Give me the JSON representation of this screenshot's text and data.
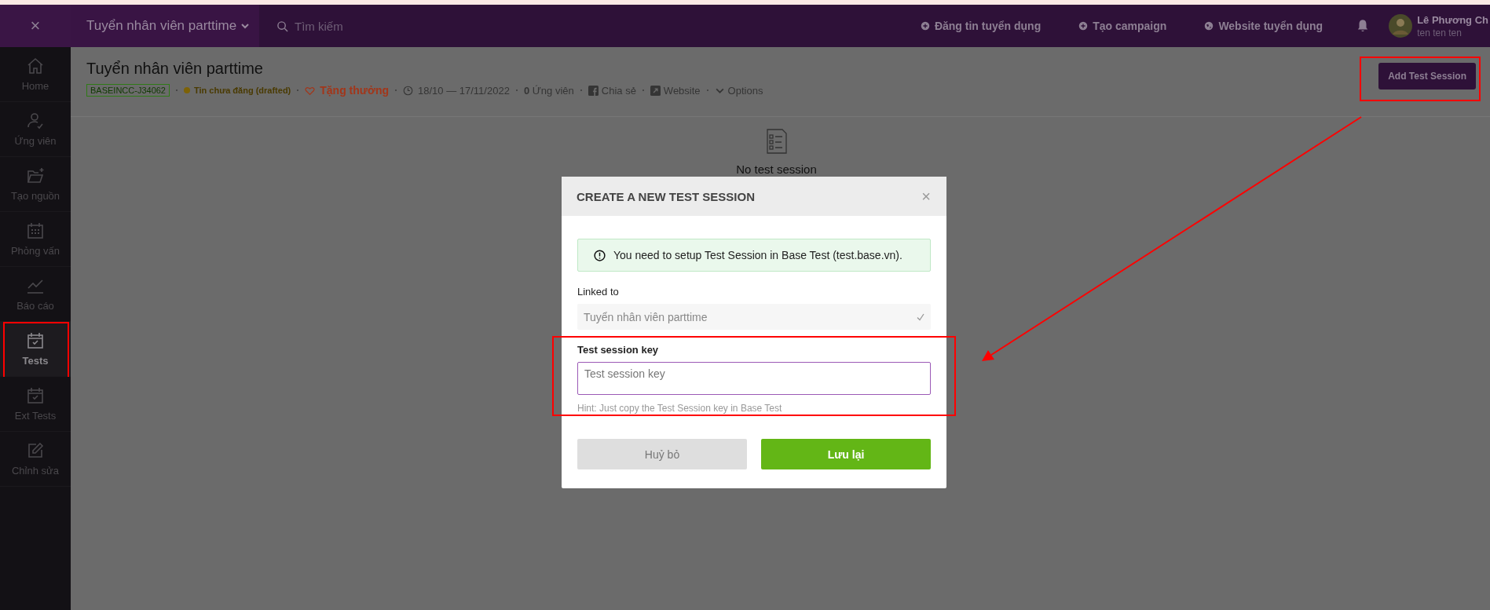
{
  "top_bar": {
    "close": "×",
    "job_selector": "Tuyển nhân viên parttime",
    "search": {
      "placeholder": "Tìm kiếm"
    },
    "actions": [
      {
        "label": "Đăng tin tuyển dụng",
        "kind": "plus"
      },
      {
        "label": "Tạo campaign",
        "kind": "plus"
      },
      {
        "label": "Website tuyển dụng",
        "kind": "globe"
      }
    ],
    "user": {
      "name": "Lê Phương Ch",
      "subtitle": "ten ten ten"
    }
  },
  "sidebar": {
    "items": [
      {
        "label": "Home",
        "kind": "home",
        "selected": false,
        "highlighted": false
      },
      {
        "label": "Ứng viên",
        "kind": "user",
        "selected": false,
        "highlighted": false
      },
      {
        "label": "Tạo nguồn",
        "kind": "folder",
        "selected": false,
        "highlighted": false
      },
      {
        "label": "Phỏng vấn",
        "kind": "calendar",
        "selected": false,
        "highlighted": false
      },
      {
        "label": "Báo cáo",
        "kind": "chart",
        "selected": false,
        "highlighted": false
      },
      {
        "label": "Tests",
        "kind": "test",
        "selected": true,
        "highlighted": true
      },
      {
        "label": "Ext Tests",
        "kind": "test",
        "selected": false,
        "highlighted": false
      },
      {
        "label": "Chỉnh sửa",
        "kind": "edit",
        "selected": false,
        "highlighted": false
      }
    ]
  },
  "job": {
    "title": "Tuyển nhân viên parttime",
    "code": "BASEINCC-J34062",
    "status": "Tin chưa đăng (drafted)",
    "reward": "Tặng thưởng",
    "dates": "18/10 — 17/11/2022",
    "applicants_count": "0",
    "applicants_label": "Ứng viên",
    "share": "Chia sẻ",
    "website": "Website",
    "options": "Options"
  },
  "add_button": {
    "label": "Add Test Session",
    "highlighted": true
  },
  "empty_state": {
    "text": "No test session"
  },
  "dialog": {
    "title": "CREATE A NEW TEST SESSION",
    "close": "×",
    "alert": "You need to setup Test Session in Base Test (test.base.vn).",
    "linked_label": "Linked to",
    "linked_value": "Tuyển nhân viên parttime",
    "key_label": "Test session key",
    "key_placeholder": "Test session key",
    "key_highlighted": true,
    "hint": "Hint: Just copy the Test Session key in Base Test",
    "buttons": [
      {
        "label": "Huỷ bỏ",
        "kind": "secondary"
      },
      {
        "label": "Lưu lại",
        "kind": "primary"
      }
    ]
  },
  "annotations": {
    "arrow": true
  }
}
